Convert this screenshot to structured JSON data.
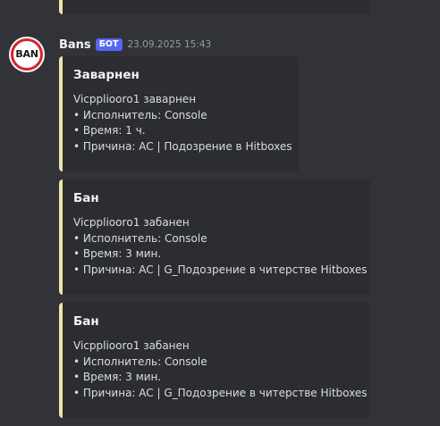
{
  "message": {
    "author": "Bans",
    "bot_tag": "БОТ",
    "timestamp": "23.09.2025 15:43",
    "avatar_text": "BAN"
  },
  "embeds": [
    {
      "title": "Заварнен",
      "lines": [
        "Vicpplioorо1 заварнен",
        "• Исполнитель: Console",
        "• Время: 1 ч.",
        "• Причина: AC | Подозрение в Hitboxes"
      ]
    },
    {
      "title": "Бан",
      "lines": [
        "Vicpplioorо1 забанен",
        "• Исполнитель: Console",
        "• Время: 3 мин.",
        "• Причина: AC | G_Подозрение в читерстве Hitboxes"
      ]
    },
    {
      "title": "Бан",
      "lines": [
        "Vicpplioorо1 забанен",
        "• Исполнитель: Console",
        "• Время: 3 мин.",
        "• Причина: AC | G_Подозрение в читерстве Hitboxes"
      ]
    }
  ],
  "colors": {
    "background": "#313338",
    "embed_background": "#2b2d31",
    "embed_accent": "#f0e3a8",
    "bot_tag": "#5865f2",
    "avatar_ring": "#d6242a"
  }
}
